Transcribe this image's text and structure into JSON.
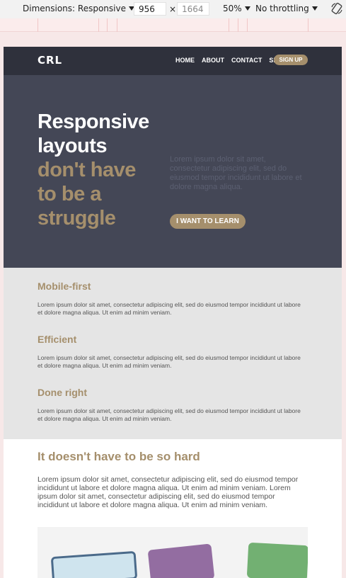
{
  "devtools": {
    "dimensions_label": "Dimensions: Responsive",
    "width_value": "956",
    "times": "×",
    "height_placeholder": "1664",
    "zoom": "50%",
    "throttling": "No throttling",
    "rotate_icon": "rotate-icon"
  },
  "site": {
    "logo": "CRL",
    "nav": [
      "HOME",
      "ABOUT",
      "CONTACT",
      "SIGN IN"
    ],
    "signup": "SIGN UP",
    "hero": {
      "title_line1": "Responsive",
      "title_line2": "layouts",
      "title_line3": "don't have",
      "title_line4": "to be a",
      "title_line5": "struggle",
      "text": "Lorem ipsum dolor sit amet, consectetur adipiscing elit, sed do eiusmod tempor incididunt ut labore et dolore magna aliqua.",
      "button": "I WANT TO LEARN"
    },
    "features": [
      {
        "title": "Mobile-first",
        "text": "Lorem ipsum dolor sit amet, consectetur adipiscing elit, sed do eiusmod tempor incididunt ut labore et dolore magna aliqua. Ut enim ad minim veniam."
      },
      {
        "title": "Efficient",
        "text": "Lorem ipsum dolor sit amet, consectetur adipiscing elit, sed do eiusmod tempor incididunt ut labore et dolore magna aliqua. Ut enim ad minim veniam."
      },
      {
        "title": "Done right",
        "text": "Lorem ipsum dolor sit amet, consectetur adipiscing elit, sed do eiusmod tempor incididunt ut labore et dolore magna aliqua. Ut enim ad minim veniam."
      }
    ],
    "content": {
      "title": "It doesn't have to be so hard",
      "text": "Lorem ipsum dolor sit amet, consectetur adipiscing elit, sed do eiusmod tempor incididunt ut labore et dolore magna aliqua. Ut enim ad minim veniam. Lorem ipsum dolor sit amet, consectetur adipiscing elit, sed do eiusmod tempor incididunt ut labore et dolore magna aliqua. Ut enim ad minim veniam."
    }
  },
  "colors": {
    "nav_bg": "#2f313c",
    "hero_bg": "#444756",
    "accent_gold": "#a58f6c",
    "features_bg": "#e5e5e5"
  }
}
